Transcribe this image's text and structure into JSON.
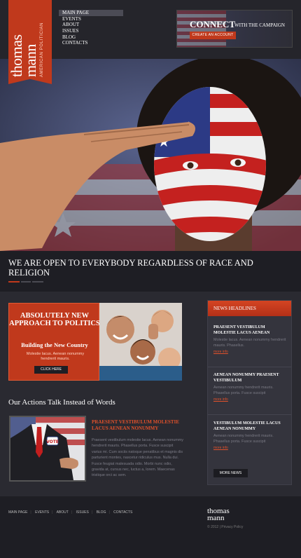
{
  "brand": {
    "name_line1": "thomas",
    "name_line2": "mann",
    "tagline": "AMERICAN POLITICIAN"
  },
  "nav": {
    "items": [
      "MAIN PAGE",
      "EVENTS",
      "ABOUT",
      "ISSUES",
      "BLOG",
      "CONTACTS"
    ]
  },
  "connect": {
    "title": "CONNECT",
    "subtitle": "WITH THE CAMPAIGN",
    "button": "CREATE AN ACCOUNT"
  },
  "hero": {
    "headline": "WE ARE OPEN TO EVERYBODY REGARDLESS OF RACE AND RELIGION"
  },
  "promo": {
    "heading": "ABSOLUTELY NEW APPROACH TO POLITICS",
    "subheading": "Building the New Country",
    "description": "Molestie lacus. Aenean nonummy hendrerit mauris.",
    "button": "CLICK HERE"
  },
  "actions": {
    "title": "Our Actions Talk Instead of Words",
    "article_title": "PRAESENT VESTIBULUM MOLESTIE LACUS AENEAN NONUMMY",
    "article_text": "Praesent vestibulum molestie lacus. Aenean nonummy hendrerit mauris. Phasellus porta. Fusce suscipit varius mi. Cum sociis natoque penatibus et magnis dis parturient montes, nascetur ridiculus mus. Nulla dui. Fusce feugiat malesuada odio. Morbi nunc odio, gravida at, cursus nec, luctus a, lorem. Maecenas tristique orci ac sem.",
    "badge": "VOTE"
  },
  "news": {
    "header": "NEWS HEADLINES",
    "items": [
      {
        "title": "PRAESENT VESTIBULUM MOLESTIE LACUS AENEAN",
        "text": "Molestie lacus. Aenean nonummy hendrerit mauris. Phasellus.",
        "more": "more info"
      },
      {
        "title": "AENEAN NONUMMY PRAESENT VESTIBULUM",
        "text": "Aenean nonummy hendrerit mauris. Phasellus porta. Fusce suscipit",
        "more": "more info"
      },
      {
        "title": "VESTIBULUM MOLESTIE LACUS AENEAN NONUMMY",
        "text": "Aenean nonummy hendrerit mauris. Phasellus porta. Fusce suscipit",
        "more": "more info"
      }
    ],
    "more_button": "MORE NEWS"
  },
  "footer": {
    "links": [
      "MAIN PAGE",
      "EVENTS",
      "ABOUT",
      "ISSUES",
      "BLOG",
      "CONTACTS"
    ],
    "logo_line1": "thomas",
    "logo_line2": "mann",
    "copyright": "© 2012  |  Privacy Policy"
  },
  "colors": {
    "accent": "#c0391c",
    "dark": "#1e1e24",
    "panel": "#34343d"
  }
}
